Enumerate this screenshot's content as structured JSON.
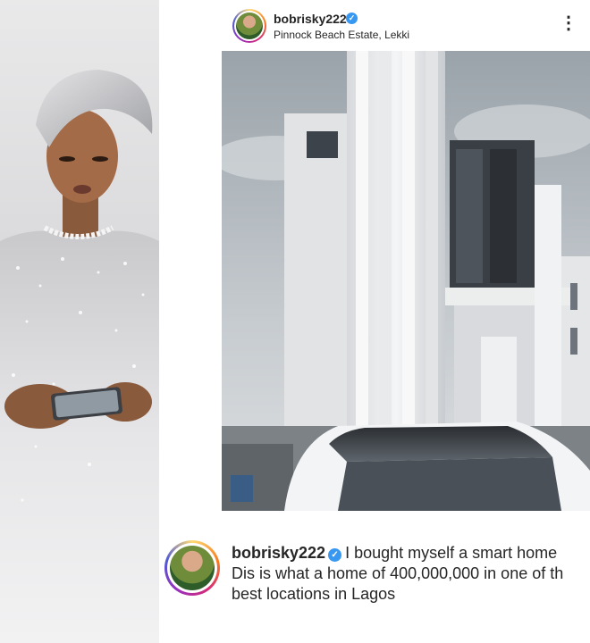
{
  "post": {
    "username": "bobrisky222",
    "verified_icon": "✓",
    "location": "Pinnock Beach Estate, Lekki",
    "more_icon": "⋮"
  },
  "caption": {
    "username": "bobrisky222",
    "verified_icon": "✓",
    "line1": "I bought myself a smart home",
    "line2": "Dis is what a home of 400,000,000 in one of th",
    "line3": "best locations in Lagos"
  },
  "colors": {
    "verified_blue": "#3897f0",
    "text_primary": "#262626"
  }
}
